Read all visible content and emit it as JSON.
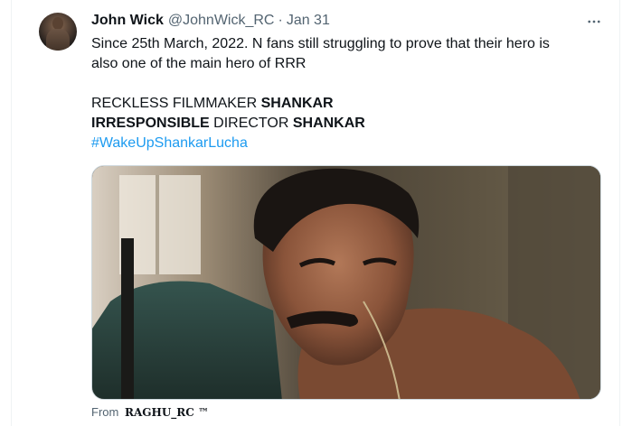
{
  "tweet": {
    "author_name": "John Wick",
    "author_handle": "@JohnWick_RC",
    "separator": "·",
    "date": "Jan 31",
    "more_icon": "more-horizontal-icon",
    "text": {
      "line1": "Since 25th March, 2022. N fans still struggling to prove that their hero is",
      "line2": "also one of the main hero of RRR",
      "line3_normal": "RECKLESS FILMMAKER ",
      "line3_bold": "SHANKAR",
      "line4_bold": "IRRESPONSIBLE",
      "line4_normal": " DIRECTOR ",
      "line4_bold2": "SHANKAR",
      "hashtag": "#WakeUpShankarLucha"
    },
    "media_attribution_prefix": "From",
    "media_attribution_source": "RAGHU_RC ™"
  },
  "colors": {
    "text": "#0f1419",
    "secondary": "#536471",
    "link": "#1d9bf0"
  }
}
